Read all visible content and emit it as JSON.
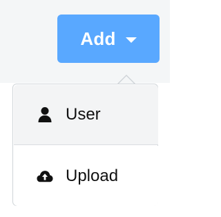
{
  "toolbar": {
    "add_button": {
      "label": "Add",
      "icon": "caret-down-icon",
      "color": "#59a8ff"
    }
  },
  "dropdown": {
    "items": [
      {
        "label": "User",
        "icon": "user-icon"
      },
      {
        "label": "Upload",
        "icon": "cloud-upload-icon"
      }
    ]
  }
}
